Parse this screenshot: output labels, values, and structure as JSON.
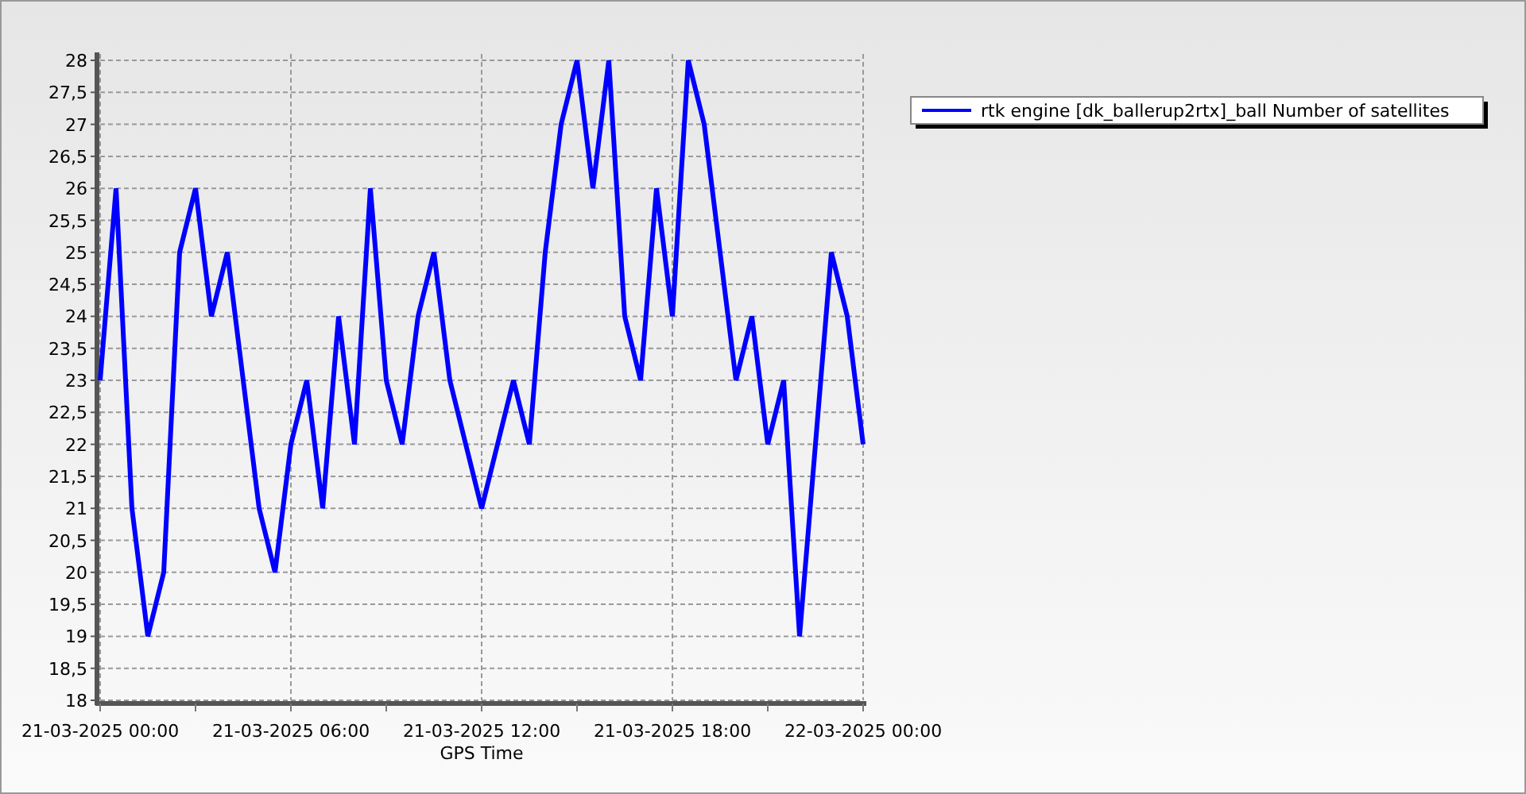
{
  "chart_data": {
    "type": "line",
    "xlabel": "GPS Time",
    "categories": [
      "21-03-2025 00:00",
      null,
      null,
      null,
      null,
      null,
      null,
      null,
      null,
      null,
      null,
      null,
      "21-03-2025 06:00",
      null,
      null,
      null,
      null,
      null,
      null,
      null,
      null,
      null,
      null,
      null,
      "21-03-2025 12:00",
      null,
      null,
      null,
      null,
      null,
      null,
      null,
      null,
      null,
      null,
      null,
      "21-03-2025 18:00",
      null,
      null,
      null,
      null,
      null,
      null,
      null,
      null,
      null,
      null,
      null,
      "22-03-2025 00:00"
    ],
    "series": [
      {
        "name": "rtk engine [dk_ballerup2rtx]_ball Number of satellites",
        "color": "#0000ff",
        "values": [
          23,
          26,
          21,
          19,
          20,
          25,
          26,
          24,
          25,
          23,
          21,
          20,
          22,
          23,
          21,
          24,
          22,
          26,
          23,
          22,
          24,
          25,
          23,
          22,
          21,
          22,
          23,
          22,
          25,
          27,
          28,
          26,
          28,
          24,
          23,
          26,
          24,
          28,
          27,
          25,
          23,
          24,
          22,
          23,
          19,
          22,
          25,
          24,
          22
        ]
      }
    ],
    "ylim": [
      18,
      28
    ],
    "grid": true,
    "yticks": [
      {
        "value": 18,
        "label": "18"
      },
      {
        "value": 18.5,
        "label": "18,5"
      },
      {
        "value": 19,
        "label": "19"
      },
      {
        "value": 19.5,
        "label": "19,5"
      },
      {
        "value": 20,
        "label": "20"
      },
      {
        "value": 20.5,
        "label": "20,5"
      },
      {
        "value": 21,
        "label": "21"
      },
      {
        "value": 21.5,
        "label": "21,5"
      },
      {
        "value": 22,
        "label": "22"
      },
      {
        "value": 22.5,
        "label": "22,5"
      },
      {
        "value": 23,
        "label": "23"
      },
      {
        "value": 23.5,
        "label": "23,5"
      },
      {
        "value": 24,
        "label": "24"
      },
      {
        "value": 24.5,
        "label": "24,5"
      },
      {
        "value": 25,
        "label": "25"
      },
      {
        "value": 25.5,
        "label": "25,5"
      },
      {
        "value": 26,
        "label": "26"
      },
      {
        "value": 26.5,
        "label": "26,5"
      },
      {
        "value": 27,
        "label": "27"
      },
      {
        "value": 27.5,
        "label": "27,5"
      },
      {
        "value": 28,
        "label": "28"
      }
    ]
  }
}
